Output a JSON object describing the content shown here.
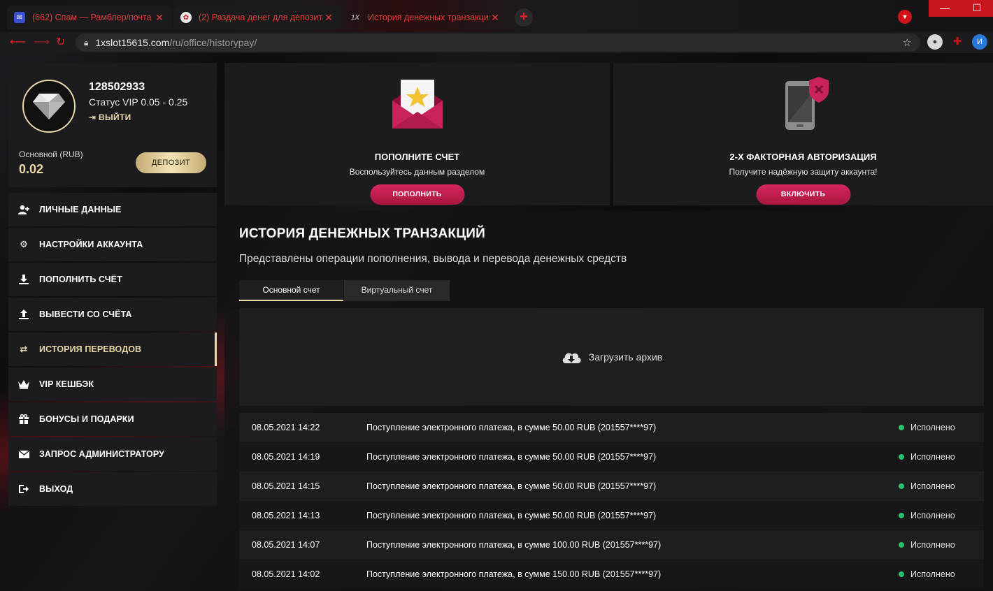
{
  "browser": {
    "tabs": [
      {
        "title": "(662) Спам — Рамблер/почта",
        "favicon": "mail-icon"
      },
      {
        "title": "(2) Раздача денег для депозита",
        "favicon": "vk-icon"
      },
      {
        "title": "История денежных транзакций",
        "favicon_text": "1X"
      }
    ],
    "new_tab": "+",
    "url_host": "1xslot15615.com",
    "url_path": "/ru/office/historypay/",
    "profile_initial": "И",
    "window_min": "—",
    "window_max": "☐",
    "colors": {
      "accent": "#e8202a"
    }
  },
  "profile": {
    "user_id": "128502933",
    "status": "Статус VIP 0.05 - 0.25",
    "logout": "ВЫЙТИ",
    "balance_label": "Основной (RUB)",
    "balance_value": "0.02",
    "deposit_button": "ДЕПОЗИТ"
  },
  "sidebar": {
    "items": [
      {
        "label": "ЛИЧНЫЕ ДАННЫЕ",
        "icon": "user-add-icon"
      },
      {
        "label": "НАСТРОЙКИ АККАУНТА",
        "icon": "gears-icon"
      },
      {
        "label": "ПОПОЛНИТЬ СЧЁТ",
        "icon": "download-icon"
      },
      {
        "label": "ВЫВЕСТИ СО СЧЁТА",
        "icon": "upload-icon"
      },
      {
        "label": "ИСТОРИЯ ПЕРЕВОДОВ",
        "icon": "transfer-icon",
        "active": true
      },
      {
        "label": "VIP КЕШБЭК",
        "icon": "crown-icon"
      },
      {
        "label": "БОНУСЫ И ПОДАРКИ",
        "icon": "gift-icon"
      },
      {
        "label": "ЗАПРОС АДМИНИСТРАТОРУ",
        "icon": "envelope-icon"
      },
      {
        "label": "ВЫХОД",
        "icon": "exit-icon"
      }
    ]
  },
  "promos": {
    "deposit": {
      "title": "ПОПОЛНИТЕ СЧЕТ",
      "subtitle": "Воспользуйтесь данным разделом",
      "button": "ПОПОЛНИТЬ"
    },
    "twofa": {
      "title": "2-Х ФАКТОРНАЯ АВТОРИЗАЦИЯ",
      "subtitle": "Получите надёжную защиту аккаунта!",
      "button": "ВКЛЮЧИТЬ"
    }
  },
  "history": {
    "title": "ИСТОРИЯ ДЕНЕЖНЫХ ТРАНЗАКЦИЙ",
    "subtitle": "Представлены операции пополнения, вывода и перевода денежных средств",
    "tabs": [
      "Основной счет",
      "Виртуальный счет"
    ],
    "archive_label": "Загрузить архив",
    "rows": [
      {
        "date": "08.05.2021 14:22",
        "desc": "Поступление электронного платежа, в сумме 50.00 RUB (201557****97)",
        "status": "Исполнено"
      },
      {
        "date": "08.05.2021 14:19",
        "desc": "Поступление электронного платежа, в сумме 50.00 RUB (201557****97)",
        "status": "Исполнено"
      },
      {
        "date": "08.05.2021 14:15",
        "desc": "Поступление электронного платежа, в сумме 50.00 RUB (201557****97)",
        "status": "Исполнено"
      },
      {
        "date": "08.05.2021 14:13",
        "desc": "Поступление электронного платежа, в сумме 50.00 RUB (201557****97)",
        "status": "Исполнено"
      },
      {
        "date": "08.05.2021 14:07",
        "desc": "Поступление электронного платежа, в сумме 100.00 RUB (201557****97)",
        "status": "Исполнено"
      },
      {
        "date": "08.05.2021 14:02",
        "desc": "Поступление электронного платежа, в сумме 150.00 RUB (201557****97)",
        "status": "Исполнено"
      }
    ],
    "colors": {
      "status_ok": "#27c26b",
      "gold": "#e8d7a8",
      "button": "#c81e50"
    }
  }
}
